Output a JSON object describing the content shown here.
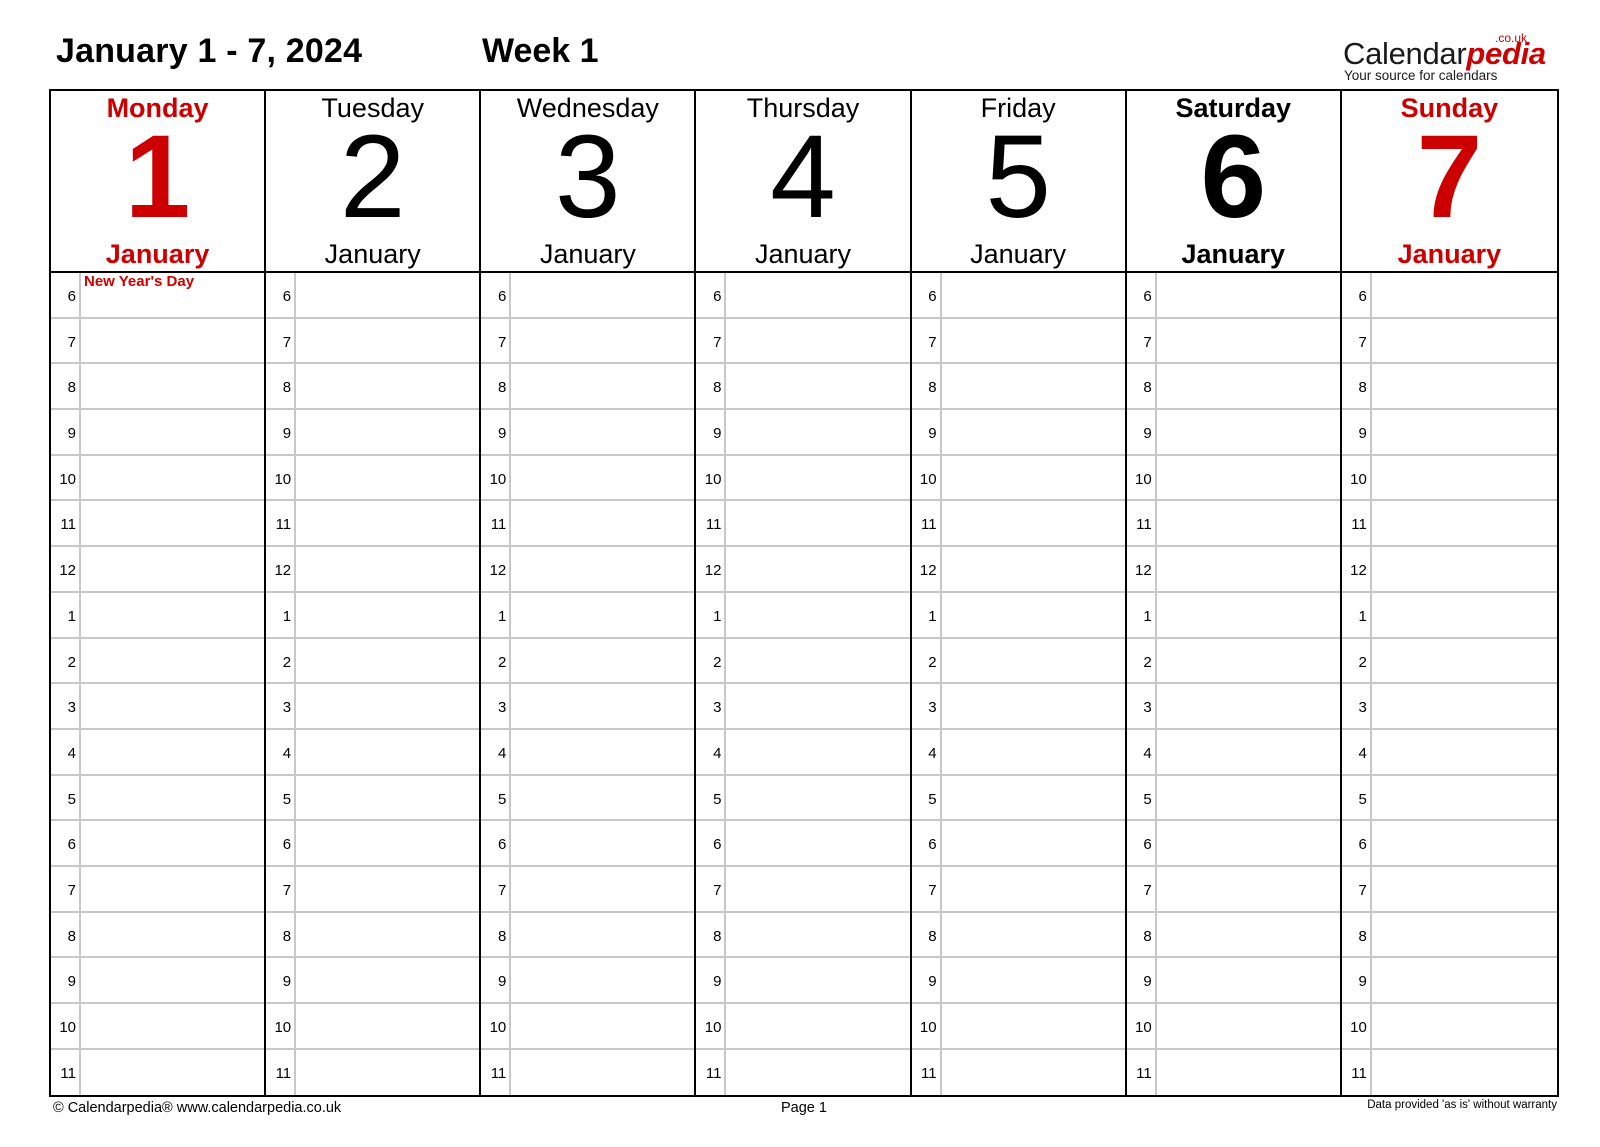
{
  "header": {
    "title": "January 1 - 7, 2024",
    "week": "Week 1"
  },
  "logo": {
    "name_part1": "Calendar",
    "name_part2": "pedia",
    "domain_suffix": ".co.uk",
    "tagline": "Your source for calendars"
  },
  "colors": {
    "accent_red": "#cc0000",
    "grid_line": "#c8c8c8",
    "border": "#000000"
  },
  "hours": [
    "6",
    "7",
    "8",
    "9",
    "10",
    "11",
    "12",
    "1",
    "2",
    "3",
    "4",
    "5",
    "6",
    "7",
    "8",
    "9",
    "10",
    "11"
  ],
  "days": [
    {
      "name": "Monday",
      "number": "1",
      "month": "January",
      "style": "red-bold",
      "events": [
        {
          "hour_index": 0,
          "label": "New Year's Day"
        }
      ]
    },
    {
      "name": "Tuesday",
      "number": "2",
      "month": "January",
      "style": "normal",
      "events": []
    },
    {
      "name": "Wednesday",
      "number": "3",
      "month": "January",
      "style": "normal",
      "events": []
    },
    {
      "name": "Thursday",
      "number": "4",
      "month": "January",
      "style": "normal",
      "events": []
    },
    {
      "name": "Friday",
      "number": "5",
      "month": "January",
      "style": "normal",
      "events": []
    },
    {
      "name": "Saturday",
      "number": "6",
      "month": "January",
      "style": "bold",
      "events": []
    },
    {
      "name": "Sunday",
      "number": "7",
      "month": "January",
      "style": "red-bold",
      "events": []
    }
  ],
  "footer": {
    "copyright": "© Calendarpedia®   www.calendarpedia.co.uk",
    "page": "Page 1",
    "disclaimer": "Data provided 'as is' without warranty"
  }
}
